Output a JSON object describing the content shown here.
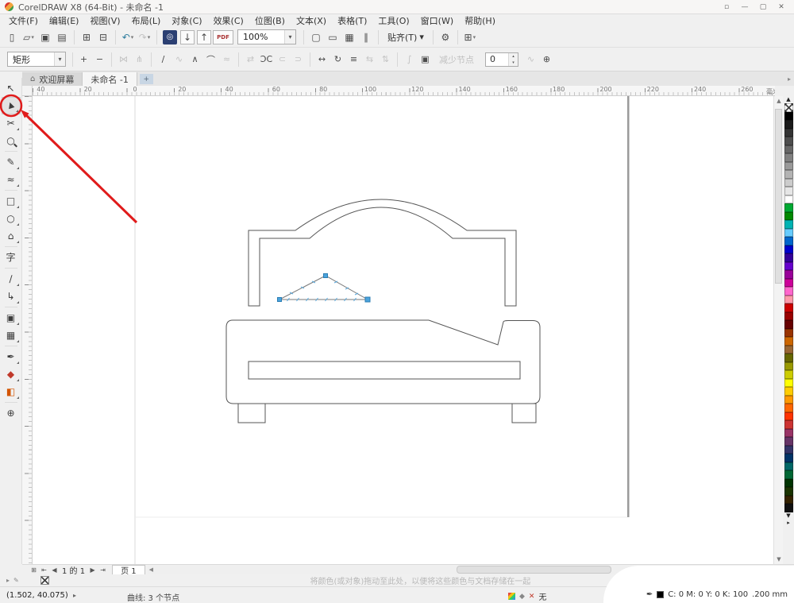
{
  "window": {
    "title": "CorelDRAW X8 (64-Bit) - 未命名 -1",
    "dock": "▫",
    "minimize": "—",
    "maximize": "▢",
    "close": "✕"
  },
  "menu": [
    "文件(F)",
    "编辑(E)",
    "视图(V)",
    "布局(L)",
    "对象(C)",
    "效果(C)",
    "位图(B)",
    "文本(X)",
    "表格(T)",
    "工具(O)",
    "窗口(W)",
    "帮助(H)"
  ],
  "toolbar": {
    "zoom_value": "100%",
    "snap_label": "贴齐(T)",
    "items": [
      {
        "t": "icon",
        "name": "new-document-icon",
        "g": "▯"
      },
      {
        "t": "icon",
        "name": "open-folder-icon",
        "g": "▱",
        "dd": true
      },
      {
        "t": "icon",
        "name": "save-icon",
        "g": "▣"
      },
      {
        "t": "icon",
        "name": "print-icon",
        "g": "▤"
      },
      {
        "t": "sep"
      },
      {
        "t": "icon",
        "name": "copy-icon",
        "g": "⊞"
      },
      {
        "t": "icon",
        "name": "paste-icon",
        "g": "⊟"
      },
      {
        "t": "sep"
      },
      {
        "t": "icon",
        "name": "undo-icon",
        "g": "↶",
        "dd": true,
        "accent": true
      },
      {
        "t": "icon",
        "name": "redo-icon",
        "g": "↷",
        "dd": true,
        "dis": true
      },
      {
        "t": "sep"
      },
      {
        "t": "icon",
        "name": "search-content-icon",
        "g": "◎",
        "dark": true
      },
      {
        "t": "icon",
        "name": "import-icon",
        "g": "↓",
        "boxed": true
      },
      {
        "t": "icon",
        "name": "export-icon",
        "g": "↑",
        "boxed": true
      },
      {
        "t": "pdf",
        "name": "publish-pdf-icon"
      },
      {
        "t": "combo",
        "name": "zoom-level-combo"
      },
      {
        "t": "sep"
      },
      {
        "t": "icon",
        "name": "fullscreen-preview-icon",
        "g": "▢"
      },
      {
        "t": "icon",
        "name": "show-rulers-icon",
        "g": "▭"
      },
      {
        "t": "icon",
        "name": "show-grid-icon",
        "g": "▦"
      },
      {
        "t": "icon",
        "name": "show-guidelines-icon",
        "g": "∥"
      },
      {
        "t": "sep"
      },
      {
        "t": "text",
        "name": "snap-to-dropdown",
        "dd": true
      },
      {
        "t": "sep"
      },
      {
        "t": "icon",
        "name": "options-icon",
        "g": "⚙"
      },
      {
        "t": "sep"
      },
      {
        "t": "icon",
        "name": "launcher-icon",
        "g": "⊞",
        "dd": true
      }
    ]
  },
  "propbar": {
    "preset": "矩形",
    "reduce_nodes": "减少节点",
    "spin_value": "0",
    "tiles": [
      {
        "g": "+",
        "n": "add-node-icon"
      },
      {
        "g": "−",
        "n": "delete-node-icon"
      },
      {
        "t": "sep"
      },
      {
        "g": "⋈",
        "n": "join-nodes-icon",
        "dis": true
      },
      {
        "g": "⋔",
        "n": "break-curve-icon",
        "dis": true
      },
      {
        "t": "sep"
      },
      {
        "g": "∕",
        "n": "convert-to-line-icon"
      },
      {
        "g": "∿",
        "n": "convert-to-curve-icon",
        "dis": true
      },
      {
        "g": "∧",
        "n": "cusp-node-icon"
      },
      {
        "g": "⌒",
        "n": "smooth-node-icon"
      },
      {
        "g": "≈",
        "n": "symmetrical-node-icon",
        "dis": true
      },
      {
        "t": "sep"
      },
      {
        "g": "⇄",
        "n": "reverse-direction-icon",
        "dis": true
      },
      {
        "g": "ƆC",
        "n": "close-curve-icon"
      },
      {
        "g": "⊂",
        "n": "extend-curve-icon",
        "dis": true
      },
      {
        "g": "⊃",
        "n": "extract-subpath-icon",
        "dis": true
      },
      {
        "t": "sep"
      },
      {
        "g": "↔",
        "n": "stretch-nodes-icon"
      },
      {
        "g": "↻",
        "n": "rotate-nodes-icon"
      },
      {
        "g": "≡",
        "n": "align-nodes-icon"
      },
      {
        "g": "⇆",
        "n": "reflect-horizontal-icon",
        "dis": true
      },
      {
        "g": "⇅",
        "n": "reflect-vertical-icon",
        "dis": true
      },
      {
        "t": "sep"
      },
      {
        "g": "∫",
        "n": "elastic-mode-icon",
        "dis": true
      },
      {
        "g": "▣",
        "n": "select-all-nodes-icon"
      }
    ],
    "tiles2": [
      {
        "g": "∿",
        "n": "curve-smoothness-icon",
        "dis": true
      },
      {
        "g": "⊕",
        "n": "select-mode-icon"
      }
    ]
  },
  "tabs": {
    "welcome": "欢迎屏幕",
    "doc": "未命名 -1",
    "add": "+",
    "home": "⌂",
    "scroll": "▸"
  },
  "hruler": {
    "labels": [
      "40",
      "20",
      "0",
      "20",
      "40",
      "60",
      "80",
      "100",
      "120",
      "140",
      "160",
      "180",
      "200",
      "220",
      "240",
      "260"
    ],
    "unit": "毫米"
  },
  "toolbox": [
    {
      "name": "pick-tool",
      "g": "↖"
    },
    {
      "name": "shape-tool",
      "g": "▲"
    },
    {
      "name": "crop-tool",
      "g": "✂"
    },
    {
      "name": "zoom-tool",
      "g": "○"
    },
    {
      "t": "sep"
    },
    {
      "name": "freehand-tool",
      "g": "✎"
    },
    {
      "name": "artistic-media-tool",
      "g": "≈"
    },
    {
      "t": "sep"
    },
    {
      "name": "rectangle-tool",
      "g": "□"
    },
    {
      "name": "ellipse-tool",
      "g": "○"
    },
    {
      "name": "polygon-tool",
      "g": "⌂"
    },
    {
      "t": "sep"
    },
    {
      "name": "text-tool",
      "g": "字"
    },
    {
      "t": "sep"
    },
    {
      "name": "dimension-tool",
      "g": "∕"
    },
    {
      "name": "connector-tool",
      "g": "↳"
    },
    {
      "t": "sep"
    },
    {
      "name": "shadow-tool",
      "g": "▣"
    },
    {
      "name": "transparency-tool",
      "g": "▦"
    },
    {
      "t": "sep"
    },
    {
      "name": "eyedropper-tool",
      "g": "✒"
    },
    {
      "name": "interactive-fill-tool",
      "g": "◆",
      "color": "#c0392b"
    },
    {
      "name": "smart-fill-tool",
      "g": "◧",
      "color": "#d35400"
    },
    {
      "t": "sep"
    },
    {
      "name": "add-tools-button",
      "g": "⊕"
    }
  ],
  "palette": {
    "colors": [
      "#000000",
      "#1a1a1a",
      "#333333",
      "#4d4d4d",
      "#666666",
      "#808080",
      "#999999",
      "#b3b3b3",
      "#cccccc",
      "#e6e6e6",
      "#ffffff",
      "#00a933",
      "#008a00",
      "#00b3b3",
      "#66ccff",
      "#0066cc",
      "#0000cc",
      "#330099",
      "#6600cc",
      "#990099",
      "#cc0099",
      "#ff66cc",
      "#ff99aa",
      "#cc0000",
      "#990000",
      "#660000",
      "#993300",
      "#cc6600",
      "#996633",
      "#666600",
      "#999900",
      "#cccc00",
      "#ffff00",
      "#ffcc00",
      "#ff9900",
      "#ff6600",
      "#ff3300",
      "#cc3333",
      "#993366",
      "#663366",
      "#333366",
      "#003366",
      "#006666",
      "#006633",
      "#003300",
      "#1a3300",
      "#332200",
      "#111111"
    ]
  },
  "nav": {
    "page_info": "1 的 1",
    "page_tab": "页 1"
  },
  "docpalette": {
    "hint": "将颜色(或对象)拖动至此处，以便将这些颜色与文档存储在一起"
  },
  "status": {
    "coords": "(1.502, 40.075)",
    "object_info": "曲线: 3 个节点",
    "fill_label": "无",
    "outline_info": "C: 0 M: 0 Y: 0 K: 100",
    "outline_width": ".200 mm"
  }
}
